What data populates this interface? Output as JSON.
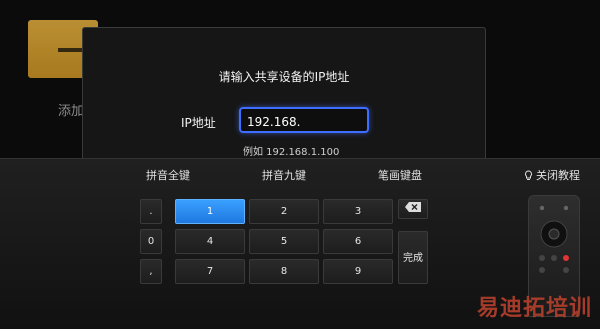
{
  "background": {
    "tile_label": "添加"
  },
  "dialog": {
    "title": "请输入共享设备的IP地址",
    "ip_label": "IP地址",
    "ip_value": "192.168.",
    "example": "例如 192.168.1.100"
  },
  "keyboard": {
    "modes": [
      "拼音全键",
      "拼音九键",
      "笔画键盘"
    ],
    "help": "关闭教程",
    "side_keys": [
      ".",
      "0",
      ","
    ],
    "number_keys": [
      "1",
      "2",
      "3",
      "4",
      "5",
      "6",
      "7",
      "8",
      "9"
    ],
    "active_key": "1",
    "done": "完成"
  },
  "colors": {
    "accent": "#3f6dff",
    "active_key": "#2d8cf0"
  },
  "watermark": "易迪拓培训"
}
